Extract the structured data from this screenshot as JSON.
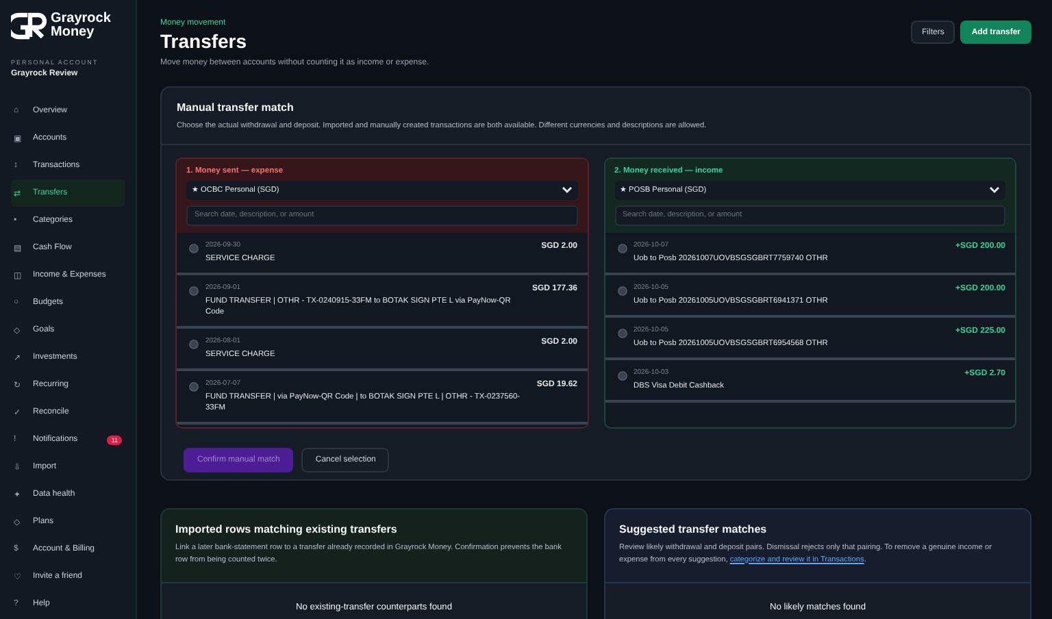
{
  "brand": {
    "name": "Grayrock",
    "sub": "Money"
  },
  "account": {
    "label": "PERSONAL ACCOUNT",
    "name": "Grayrock Review"
  },
  "nav": [
    {
      "icon": "⌂",
      "label": "Overview",
      "selected": false
    },
    {
      "icon": "▣",
      "label": "Accounts",
      "selected": false
    },
    {
      "icon": "↕",
      "label": "Transactions",
      "selected": false
    },
    {
      "icon": "⇄",
      "label": "Transfers",
      "selected": true
    },
    {
      "icon": "▪",
      "label": "Categories",
      "selected": false
    },
    {
      "icon": "▤",
      "label": "Cash Flow",
      "selected": false
    },
    {
      "icon": "◫",
      "label": "Income & Expenses",
      "selected": false
    },
    {
      "icon": "○",
      "label": "Budgets",
      "selected": false
    },
    {
      "icon": "◇",
      "label": "Goals",
      "selected": false
    },
    {
      "icon": "↗",
      "label": "Investments",
      "selected": false
    },
    {
      "icon": "↻",
      "label": "Recurring",
      "selected": false
    },
    {
      "icon": "✓",
      "label": "Reconcile",
      "selected": false
    },
    {
      "icon": "!",
      "label": "Notifications",
      "selected": false,
      "badge": "11"
    },
    {
      "icon": "⇩",
      "label": "Import",
      "selected": false
    },
    {
      "icon": "✦",
      "label": "Data health",
      "selected": false
    },
    {
      "icon": "◇",
      "label": "Plans",
      "selected": false
    },
    {
      "icon": "$",
      "label": "Account & Billing",
      "selected": false
    },
    {
      "icon": "♡",
      "label": "Invite a friend",
      "selected": false
    },
    {
      "icon": "?",
      "label": "Help",
      "selected": false
    }
  ],
  "header": {
    "eyebrow": "Money movement",
    "title": "Transfers",
    "subtitle": "Move money between accounts without counting it as income or expense.",
    "buttons": [
      {
        "label": "Filters",
        "kind": "secondary"
      },
      {
        "label": "Add transfer",
        "kind": "primary"
      }
    ]
  },
  "manual": {
    "title": "Manual transfer match",
    "description": "Choose the actual withdrawal and deposit. Imported and manually created transactions are both available. Different currencies and descriptions are allowed.",
    "panels": [
      {
        "kind": "expense",
        "title": "1. Money sent — expense",
        "account": "★ OCBC Personal (SGD)",
        "placeholder": "Search date, description, or amount",
        "rows": [
          {
            "date": "2026-09-30",
            "description": "SERVICE CHARGE",
            "amount": "SGD 2.00",
            "selected": false
          },
          {
            "date": "2026-09-01",
            "description": "FUND TRANSFER | OTHR - TX-0240915-33FM to BOTAK SIGN PTE L via PayNow-QR Code",
            "amount": "SGD 177.36",
            "selected": false
          },
          {
            "date": "2026-08-01",
            "description": "SERVICE CHARGE",
            "amount": "SGD 2.00",
            "selected": false
          },
          {
            "date": "2026-07-07",
            "description": "FUND TRANSFER | via PayNow-QR Code | to BOTAK SIGN PTE L | OTHR - TX-0237560-33FM",
            "amount": "SGD 19.62",
            "selected": false
          }
        ]
      },
      {
        "kind": "income",
        "title": "2. Money received — income",
        "account": "★ POSB Personal (SGD)",
        "placeholder": "Search date, description, or amount",
        "rows": [
          {
            "date": "2026-10-07",
            "description": "Uob to Posb 20261007UOVBSGSGBRT7759740 OTHR",
            "amount": "+SGD 200.00",
            "selected": false
          },
          {
            "date": "2026-10-05",
            "description": "Uob to Posb 20261005UOVBSGSGBRT6941371 OTHR",
            "amount": "+SGD 200.00",
            "selected": false
          },
          {
            "date": "2026-10-05",
            "description": "Uob to Posb 20261005UOVBSGSGBRT6954568 OTHR",
            "amount": "+SGD 225.00",
            "selected": false
          },
          {
            "date": "2026-10-03",
            "description": "DBS Visa Debit Cashback",
            "amount": "+SGD 2.70",
            "selected": false
          }
        ]
      }
    ],
    "actions": [
      {
        "label": "Confirm manual match",
        "kind": "primary",
        "disabled": true
      },
      {
        "label": "Cancel selection",
        "kind": "secondary",
        "disabled": false
      }
    ]
  },
  "cards": [
    {
      "kind": "imported",
      "title": "Imported rows matching existing transfers",
      "description": "Link a later bank-statement row to a transfer already recorded in Grayrock Money. Confirmation prevents the bank row from being counted twice.",
      "empty": "No existing-transfer counterparts found"
    },
    {
      "kind": "suggested",
      "title": "Suggested transfer matches",
      "description": "Review likely withdrawal and deposit pairs. Dismissal rejects only that pairing. To remove a genuine income or expense from every suggestion, ",
      "link": "categorize and review it in Transactions",
      "after": ".",
      "empty": "No likely matches found"
    }
  ]
}
